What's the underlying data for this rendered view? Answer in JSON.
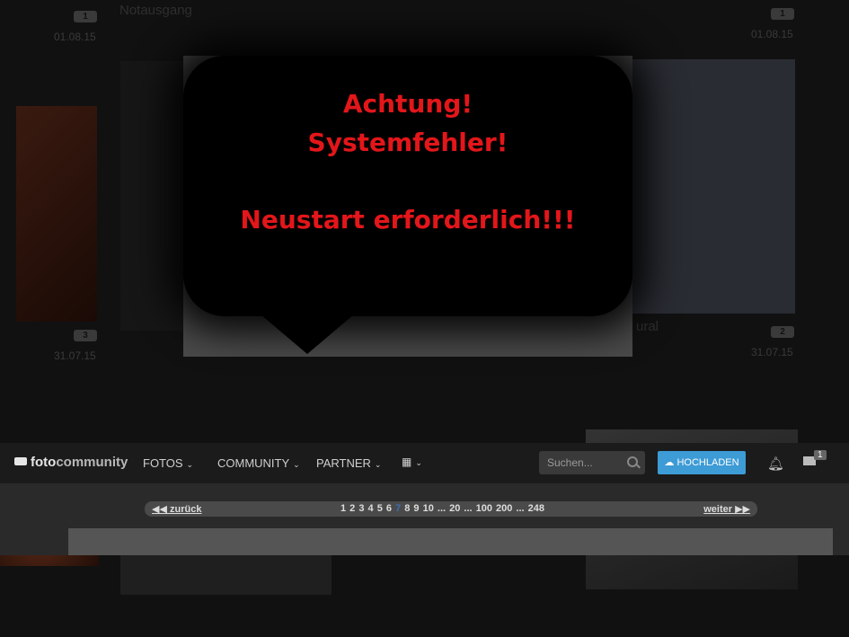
{
  "background": {
    "items": [
      {
        "title": "Notausgang",
        "count": "1",
        "date": "01.08.15"
      },
      {
        "count": "1",
        "date": "01.08.15"
      },
      {
        "count": "3",
        "date": "31.07.15"
      },
      {
        "title_fragment": "ural",
        "count": "2",
        "date": "31.07.15"
      }
    ]
  },
  "dialog": {
    "line1": "Achtung!",
    "line2": "Systemfehler!",
    "line3": "Neustart erforderlich!!!",
    "text_color": "#e3161a"
  },
  "navbar": {
    "logo_part1": "foto",
    "logo_part2": "community",
    "items": [
      {
        "label": "FOTOS",
        "icon": "chevron-down-icon"
      },
      {
        "label": "COMMUNITY",
        "icon": "chevron-down-icon"
      },
      {
        "label": "PARTNER",
        "icon": "chevron-down-icon"
      }
    ],
    "grid_icon": "grid-icon",
    "search_placeholder": "Suchen...",
    "upload_label": "HOCHLADEN",
    "upload_color": "#3d9bd6",
    "notifications_icon": "bell-icon",
    "messages_icon": "envelope-icon",
    "messages_badge": "1"
  },
  "pager": {
    "prev_label": "zurück",
    "next_label": "weiter",
    "pages_before": "1 2 3 4 5 6",
    "current": "7",
    "pages_after": "8 9 10 ... 20 ... 100 200 ... 248"
  }
}
